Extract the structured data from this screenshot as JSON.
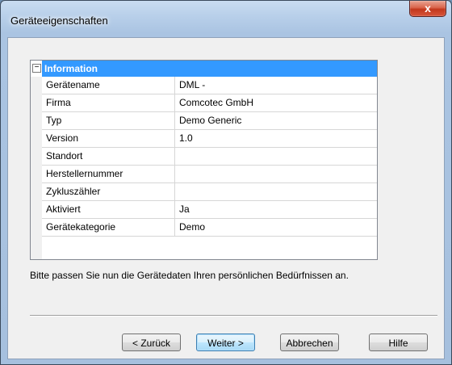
{
  "window": {
    "title": "Geräteeigenschaften",
    "close_glyph": "x"
  },
  "grid": {
    "expander_glyph": "−",
    "category": "Information",
    "rows": [
      {
        "name": "Gerätename",
        "value": "DML -"
      },
      {
        "name": "Firma",
        "value": "Comcotec GmbH"
      },
      {
        "name": "Typ",
        "value": "Demo Generic"
      },
      {
        "name": "Version",
        "value": "1.0"
      },
      {
        "name": "Standort",
        "value": ""
      },
      {
        "name": "Herstellernummer",
        "value": ""
      },
      {
        "name": "Zykluszähler",
        "value": ""
      },
      {
        "name": "Aktiviert",
        "value": "Ja"
      },
      {
        "name": "Gerätekategorie",
        "value": "Demo"
      }
    ]
  },
  "hint": "Bitte passen Sie nun die Gerätedaten Ihren persönlichen Bedürfnissen an.",
  "buttons": {
    "back": "< Zurück",
    "next": "Weiter >",
    "cancel": "Abbrechen",
    "help": "Hilfe"
  }
}
